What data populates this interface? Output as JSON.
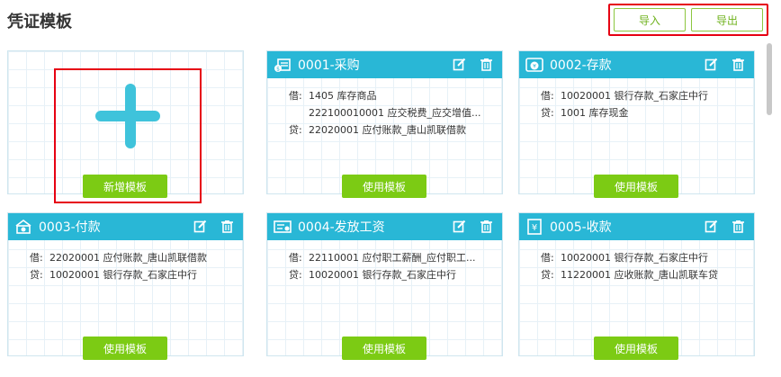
{
  "page": {
    "title": "凭证模板"
  },
  "toolbar": {
    "import_label": "导入",
    "export_label": "导出"
  },
  "add_card": {
    "label": "新增模板"
  },
  "templates": [
    {
      "title": "0001-采购",
      "icon": "purchase-icon",
      "button": "使用模板",
      "entries": [
        {
          "dir": "借:",
          "account": "1405 库存商品"
        },
        {
          "dir": "",
          "account": "222100010001 应交税费_应交增值..."
        },
        {
          "dir": "贷:",
          "account": "22020001 应付账款_唐山凯联借款"
        }
      ]
    },
    {
      "title": "0002-存款",
      "icon": "deposit-icon",
      "button": "使用模板",
      "entries": [
        {
          "dir": "借:",
          "account": "10020001 银行存款_石家庄中行"
        },
        {
          "dir": "贷:",
          "account": "1001 库存现金"
        }
      ]
    },
    {
      "title": "0003-付款",
      "icon": "payment-icon",
      "button": "使用模板",
      "entries": [
        {
          "dir": "借:",
          "account": "22020001 应付账款_唐山凯联借款"
        },
        {
          "dir": "贷:",
          "account": "10020001 银行存款_石家庄中行"
        }
      ]
    },
    {
      "title": "0004-发放工资",
      "icon": "salary-icon",
      "button": "使用模板",
      "entries": [
        {
          "dir": "借:",
          "account": "22110001 应付职工薪酬_应付职工..."
        },
        {
          "dir": "贷:",
          "account": "10020001 银行存款_石家庄中行"
        }
      ]
    },
    {
      "title": "0005-收款",
      "icon": "receipt-icon",
      "button": "使用模板",
      "entries": [
        {
          "dir": "借:",
          "account": "10020001 银行存款_石家庄中行"
        },
        {
          "dir": "贷:",
          "account": "11220001 应收账款_唐山凯联车贷"
        }
      ]
    }
  ],
  "colors": {
    "header": "#29b7d6",
    "button": "#7ccb14",
    "highlight": "#e60012"
  }
}
